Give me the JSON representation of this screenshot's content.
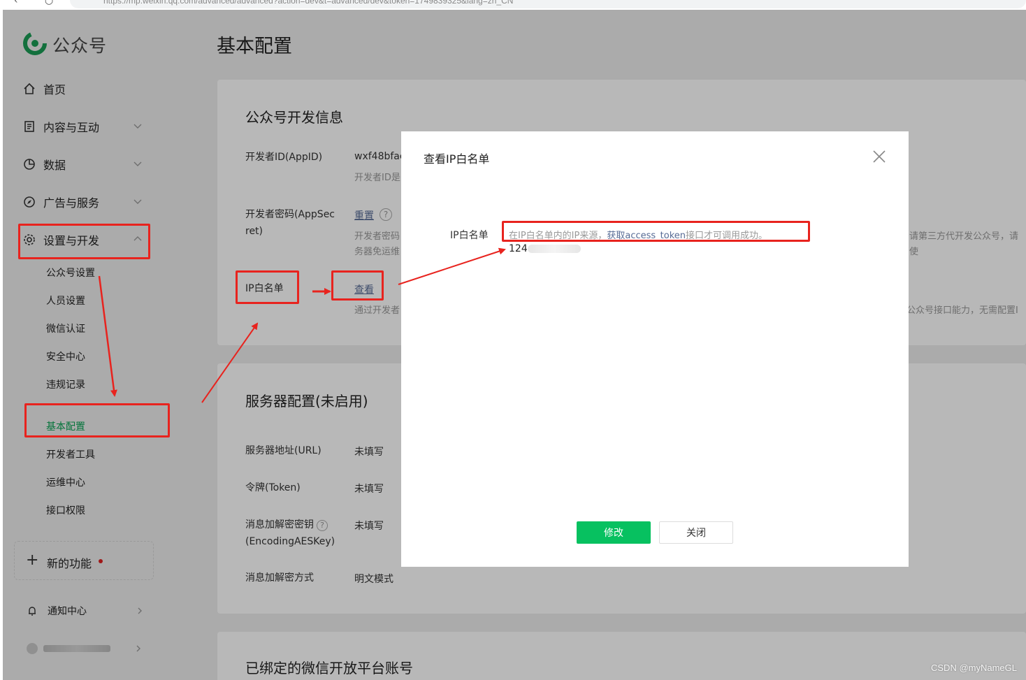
{
  "browser": {
    "url": "https://mp.weixin.qq.com/advanced/advanced?action=dev&t=advanced/dev&token=1749839325&lang=zh_CN"
  },
  "sidebar": {
    "brand": "公众号",
    "items": [
      {
        "label": "首页",
        "icon": "home-icon"
      },
      {
        "label": "内容与互动",
        "icon": "document-icon"
      },
      {
        "label": "数据",
        "icon": "pie-chart-icon"
      },
      {
        "label": "广告与服务",
        "icon": "compass-icon"
      },
      {
        "label": "设置与开发",
        "icon": "gear-icon"
      }
    ],
    "sub_items": [
      "公众号设置",
      "人员设置",
      "微信认证",
      "安全中心",
      "违规记录",
      "基本配置",
      "开发者工具",
      "运维中心",
      "接口权限"
    ],
    "new_feature": "新的功能",
    "notice": "通知中心"
  },
  "page": {
    "title": "基本配置",
    "section1": {
      "title": "公众号开发信息",
      "appid_label": "开发者ID(AppID)",
      "appid_value": "wxf48bfac",
      "appid_note": "开发者ID是",
      "secret_label_1": "开发者密码(AppSec",
      "secret_label_2": "ret)",
      "secret_reset": "重置",
      "secret_note_1": "开发者密码",
      "secret_note_2": "务器免运维",
      "secret_note_right": "请第三方代开发公众号，请使",
      "ip_label": "IP白名单",
      "ip_view": "查看",
      "ip_note": "通过开发者",
      "ip_note_right": "公众号接口能力，无需配置I"
    },
    "section2": {
      "title": "服务器配置(未启用)",
      "rows": [
        {
          "label": "服务器地址(URL)",
          "value": "未填写"
        },
        {
          "label": "令牌(Token)",
          "value": "未填写"
        },
        {
          "label": "消息加解密密钥",
          "label2": "(EncodingAESKey)",
          "value": "未填写"
        },
        {
          "label": "消息加解密方式",
          "value": "明文模式"
        }
      ]
    },
    "section3": {
      "title": "已绑定的微信开放平台账号"
    }
  },
  "modal": {
    "title": "查看IP白名单",
    "label": "IP白名单",
    "tip_prefix": "在IP白名单内的IP来源，",
    "tip_link": "获取access_token",
    "tip_suffix": "接口才可调用成功。",
    "ip_visible": "124",
    "confirm": "修改",
    "cancel": "关闭"
  },
  "watermark": "CSDN @myNameGL",
  "colors": {
    "accent_green": "#07c160",
    "active_text": "#07a152",
    "link": "#576b95",
    "annotation_red": "#e8231e"
  }
}
